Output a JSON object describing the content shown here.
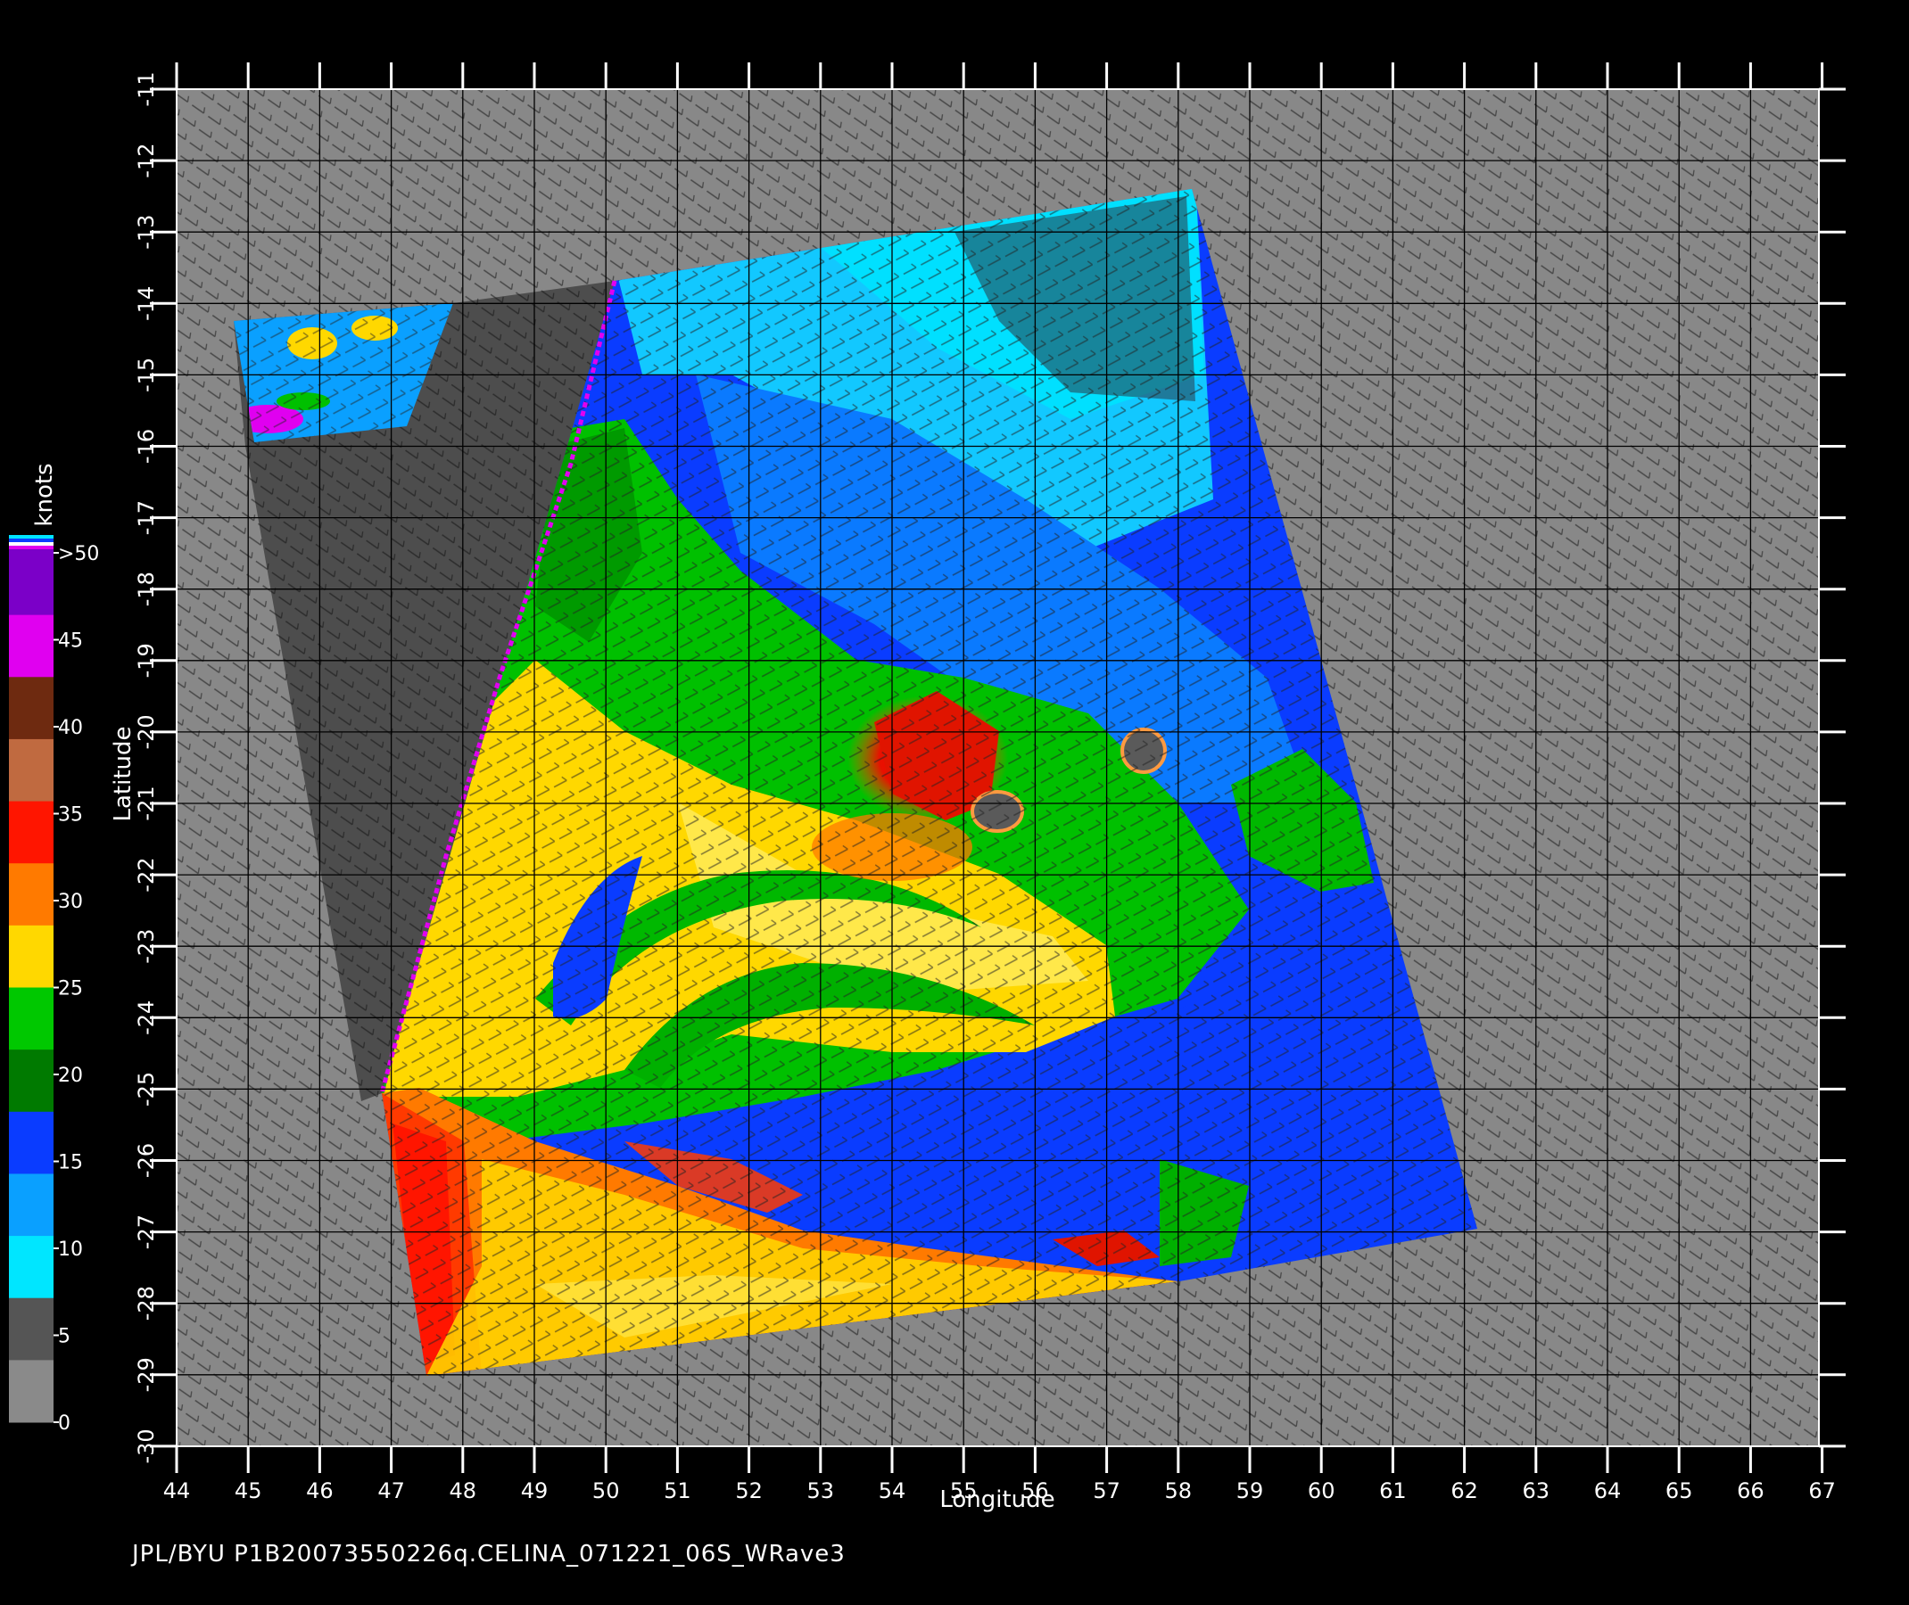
{
  "map": {
    "x_axis_label": "Longitude",
    "y_axis_label": "Latitude",
    "lon_ticks": [
      "44",
      "45",
      "46",
      "47",
      "48",
      "49",
      "50",
      "51",
      "52",
      "53",
      "54",
      "55",
      "56",
      "57",
      "58",
      "59",
      "60",
      "61",
      "62",
      "63",
      "64",
      "65",
      "66",
      "67"
    ],
    "lat_ticks": [
      "-11",
      "-12",
      "-13",
      "-14",
      "-15",
      "-16",
      "-17",
      "-18",
      "-19",
      "-20",
      "-21",
      "-22",
      "-23",
      "-24",
      "-25",
      "-26",
      "-27",
      "-28",
      "-29",
      "-30"
    ]
  },
  "colorbar": {
    "unit": "knots",
    "labels": [
      ">50",
      "45",
      "40",
      "35",
      "30",
      "25",
      "20",
      "15",
      "10",
      "5",
      "0"
    ],
    "bands": [
      {
        "color": "#7b00c8"
      },
      {
        "color": "#e000f0"
      },
      {
        "color": "#6e2a10"
      },
      {
        "color": "#c06a40"
      },
      {
        "color": "#ff1500"
      },
      {
        "color": "#ff7a00"
      },
      {
        "color": "#ffd800"
      },
      {
        "color": "#00c800"
      },
      {
        "color": "#007a00"
      },
      {
        "color": "#0a3cff"
      },
      {
        "color": "#0aa0ff"
      },
      {
        "color": "#00e6ff"
      },
      {
        "color": "#555555"
      },
      {
        "color": "#8a8a8a"
      }
    ]
  },
  "footer": {
    "text": "JPL/BYU  P1B20073550226q.CELINA_071221_06S_WRave3"
  }
}
